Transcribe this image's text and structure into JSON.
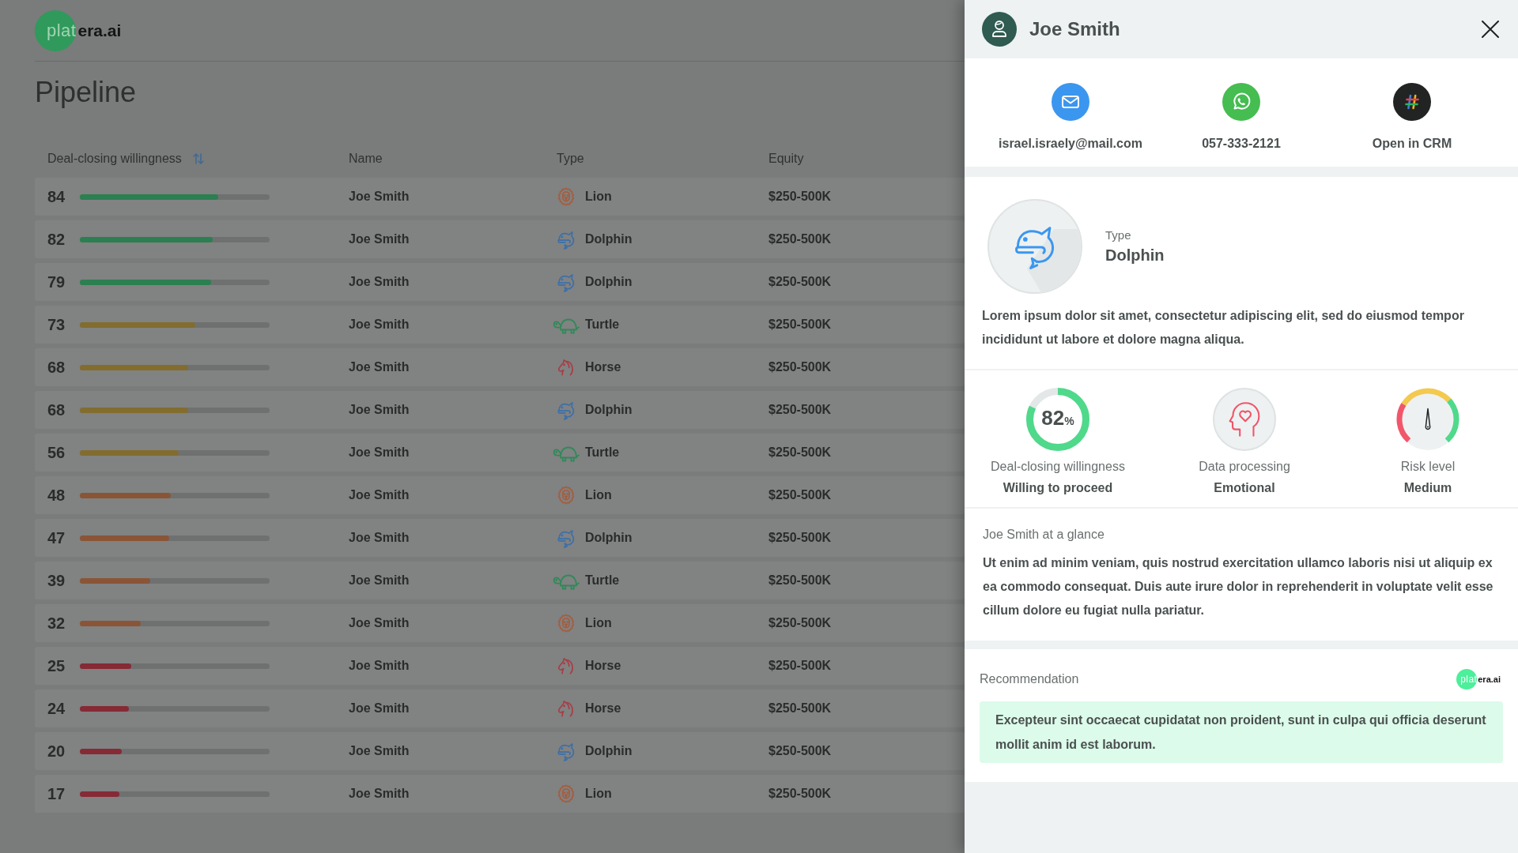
{
  "logo": {
    "mark": "plat",
    "text": "era.ai"
  },
  "page_title": "Pipeline",
  "table": {
    "columns": [
      {
        "label": "Deal-closing willingness",
        "sortable": true
      },
      {
        "label": "Name",
        "sortable": false
      },
      {
        "label": "Type",
        "sortable": false
      },
      {
        "label": "Equity",
        "sortable": false
      }
    ],
    "rows": [
      {
        "score": "84",
        "level": 0.73,
        "color": "#2b7f50",
        "name": "Joe Smith",
        "kind": "lion",
        "type": "Lion",
        "equity": "$250-500K"
      },
      {
        "score": "82",
        "level": 0.7,
        "color": "#2b7f50",
        "name": "Joe Smith",
        "kind": "dolphin",
        "type": "Dolphin",
        "equity": "$250-500K"
      },
      {
        "score": "79",
        "level": 0.69,
        "color": "#2b7f50",
        "name": "Joe Smith",
        "kind": "dolphin",
        "type": "Dolphin",
        "equity": "$250-500K"
      },
      {
        "score": "73",
        "level": 0.61,
        "color": "#826d2f",
        "name": "Joe Smith",
        "kind": "turtle",
        "type": "Turtle",
        "equity": "$250-500K"
      },
      {
        "score": "68",
        "level": 0.57,
        "color": "#826d2f",
        "name": "Joe Smith",
        "kind": "horse",
        "type": "Horse",
        "equity": "$250-500K"
      },
      {
        "score": "68",
        "level": 0.57,
        "color": "#826d2f",
        "name": "Joe Smith",
        "kind": "dolphin",
        "type": "Dolphin",
        "equity": "$250-500K"
      },
      {
        "score": "56",
        "level": 0.52,
        "color": "#826d2f",
        "name": "Joe Smith",
        "kind": "turtle",
        "type": "Turtle",
        "equity": "$250-500K"
      },
      {
        "score": "48",
        "level": 0.48,
        "color": "#8a5536",
        "name": "Joe Smith",
        "kind": "lion",
        "type": "Lion",
        "equity": "$250-500K"
      },
      {
        "score": "47",
        "level": 0.47,
        "color": "#8a5536",
        "name": "Joe Smith",
        "kind": "dolphin",
        "type": "Dolphin",
        "equity": "$250-500K"
      },
      {
        "score": "39",
        "level": 0.37,
        "color": "#8a5536",
        "name": "Joe Smith",
        "kind": "turtle",
        "type": "Turtle",
        "equity": "$250-500K"
      },
      {
        "score": "32",
        "level": 0.32,
        "color": "#8a5536",
        "name": "Joe Smith",
        "kind": "lion",
        "type": "Lion",
        "equity": "$250-500K"
      },
      {
        "score": "25",
        "level": 0.27,
        "color": "#862a36",
        "name": "Joe Smith",
        "kind": "horse",
        "type": "Horse",
        "equity": "$250-500K"
      },
      {
        "score": "24",
        "level": 0.26,
        "color": "#862a36",
        "name": "Joe Smith",
        "kind": "horse",
        "type": "Horse",
        "equity": "$250-500K"
      },
      {
        "score": "20",
        "level": 0.22,
        "color": "#862a36",
        "name": "Joe Smith",
        "kind": "dolphin",
        "type": "Dolphin",
        "equity": "$250-500K"
      },
      {
        "score": "17",
        "level": 0.21,
        "color": "#862a36",
        "name": "Joe Smith",
        "kind": "lion",
        "type": "Lion",
        "equity": "$250-500K"
      }
    ]
  },
  "panel": {
    "title": "Joe Smith",
    "contacts": [
      {
        "kind": "email",
        "label": "israel.israely@mail.com"
      },
      {
        "kind": "whatsapp",
        "label": "057-333-2121"
      },
      {
        "kind": "crm",
        "label": "Open in CRM"
      }
    ],
    "type": {
      "label": "Type",
      "value": "Dolphin",
      "kind": "dolphin"
    },
    "description": "Lorem ipsum dolor sit amet, consectetur adipiscing elit, sed do eiusmod tempor incididunt ut labore et dolore magna aliqua.",
    "metrics": [
      {
        "kind": "ring",
        "value": "82",
        "unit": "%",
        "level": 0.82,
        "label": "Deal-closing willingness",
        "reading": "Willing to proceed"
      },
      {
        "kind": "badge",
        "label": "Data processing",
        "reading": "Emotional"
      },
      {
        "kind": "gauge",
        "level": 0.5,
        "label": "Risk level",
        "reading": "Medium"
      }
    ],
    "glance": {
      "title": "Joe Smith at a glance",
      "text": "Ut enim ad minim veniam, quis nostrud exercitation ullamco laboris nisi ut aliquip ex ea commodo consequat. Duis aute irure dolor in reprehenderit in voluptate velit esse cillum dolore eu fugiat nulla pariatur."
    },
    "recommendation": {
      "title": "Recommendation",
      "logo": {
        "mark": "plat",
        "text": "era.ai"
      },
      "text": "Excepteur sint occaecat cupidatat non proident, sunt in culpa qui officia deserunt mollit anim id est laborum."
    }
  }
}
